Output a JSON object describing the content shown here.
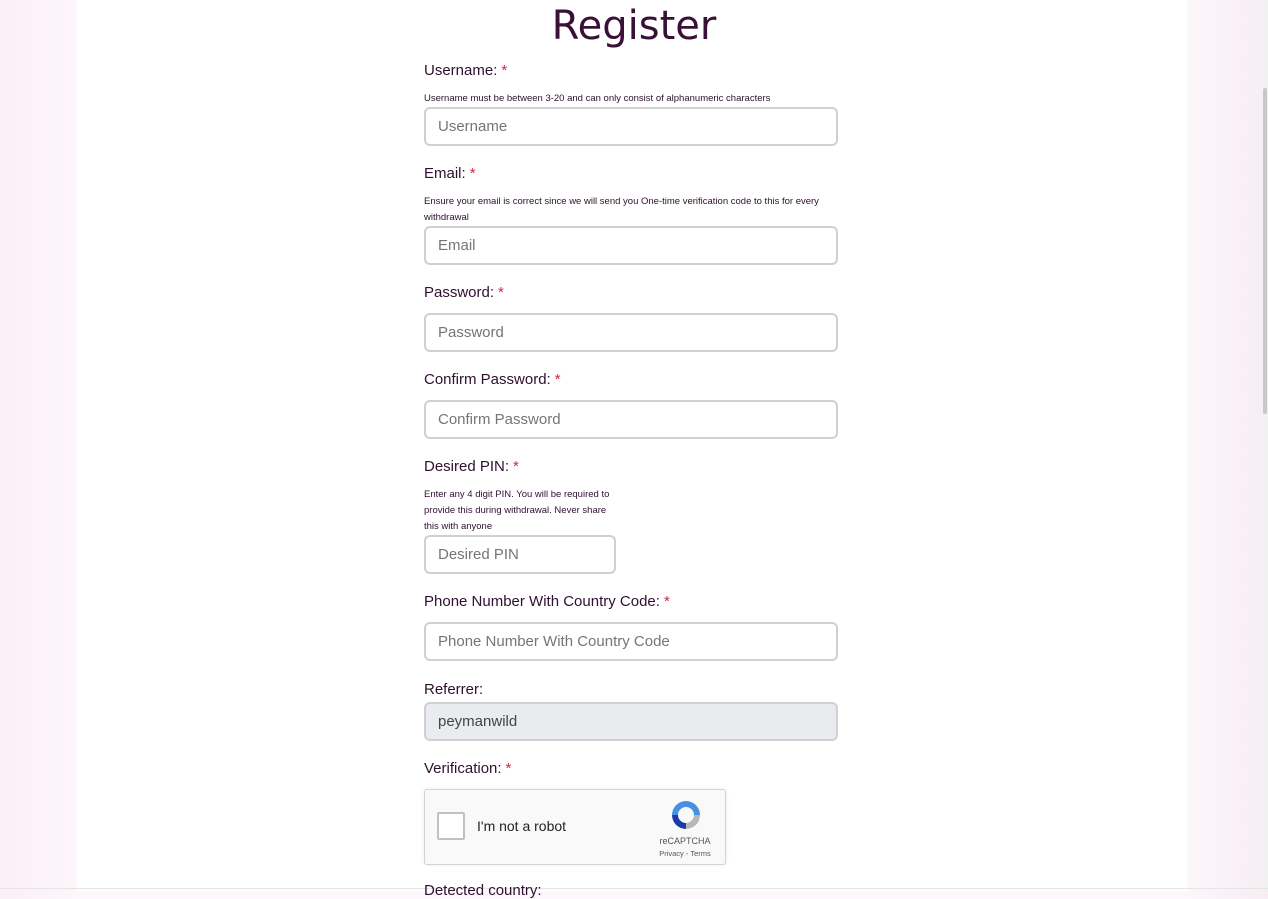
{
  "form": {
    "title": "Register",
    "username": {
      "label": "Username:",
      "required": "*",
      "help": "Username must be between 3-20 and can only consist of alphanumeric characters",
      "placeholder": "Username"
    },
    "email": {
      "label": "Email:",
      "required": "*",
      "help_line1": "Ensure your email is correct since we will send you One-time verification code to this for every",
      "help_line2": "withdrawal",
      "placeholder": "Email"
    },
    "password": {
      "label": "Password:",
      "required": "*",
      "placeholder": "Password"
    },
    "confirm_password": {
      "label": "Confirm Password:",
      "required": "*",
      "placeholder": "Confirm Password"
    },
    "pin": {
      "label": "Desired PIN:",
      "required": "*",
      "help_line1": "Enter any 4 digit PIN. You will be required to",
      "help_line2": "provide this during withdrawal. Never share",
      "help_line3": "this with anyone",
      "placeholder": "Desired PIN"
    },
    "phone": {
      "label": "Phone Number With Country Code:",
      "required": "*",
      "placeholder": "Phone Number With Country Code"
    },
    "referrer": {
      "label": "Referrer:",
      "value": "peymanwild"
    },
    "verification": {
      "label": "Verification:",
      "required": "*"
    },
    "recaptcha": {
      "checkbox_label": "I'm not a robot",
      "brand": "reCAPTCHA",
      "links": "Privacy - Terms"
    },
    "next_label_partial": "Detected country:"
  },
  "colors": {
    "title": "#3a1136",
    "required": "#d0283f",
    "page_bg": "#fdf6fa"
  }
}
